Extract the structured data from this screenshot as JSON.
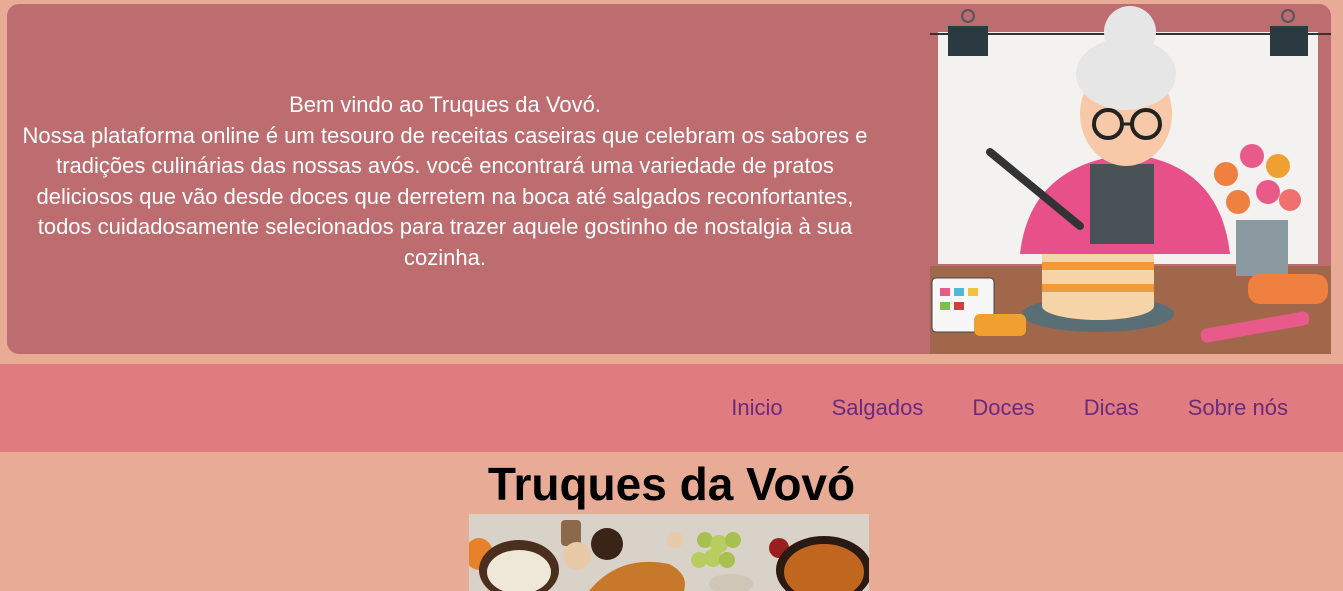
{
  "hero": {
    "line1": "Bem vindo ao Truques da Vovó.",
    "paragraph": "Nossa plataforma online é um tesouro de receitas caseiras que celebram os sabores e tradições culinárias das nossas avós. você encontrará uma variedade de pratos deliciosos que vão desde doces que derretem na boca até salgados reconfortantes, todos cuidadosamente selecionados para trazer aquele gostinho de nostalgia à sua cozinha.",
    "image_icon": "grandma-decorating-cake-illustration"
  },
  "nav": {
    "items": [
      {
        "label": "Inicio"
      },
      {
        "label": "Salgados"
      },
      {
        "label": "Doces"
      },
      {
        "label": "Dicas"
      },
      {
        "label": "Sobre nós"
      }
    ]
  },
  "main": {
    "title": "Truques da Vovó",
    "banner_icon": "food-spread-photo"
  },
  "colors": {
    "page_bg": "#e8ab96",
    "hero_panel": "#bd6c70",
    "nav_bg": "#e07c80",
    "nav_link": "#6b2a7a"
  }
}
